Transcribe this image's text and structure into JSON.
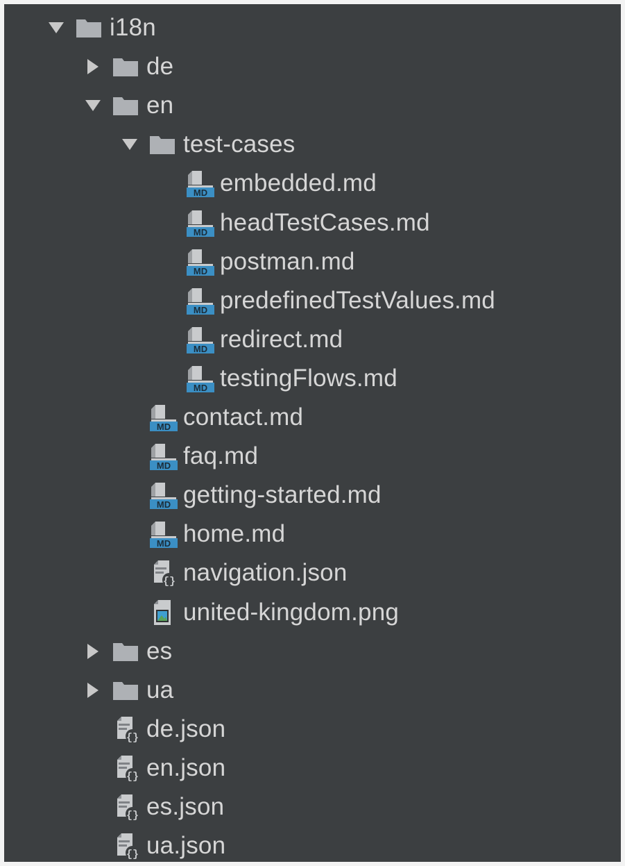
{
  "tree": {
    "items": [
      {
        "label": "i18n",
        "type": "folder",
        "expanded": true,
        "depth": 0
      },
      {
        "label": "de",
        "type": "folder",
        "expanded": false,
        "depth": 1
      },
      {
        "label": "en",
        "type": "folder",
        "expanded": true,
        "depth": 1
      },
      {
        "label": "test-cases",
        "type": "folder",
        "expanded": true,
        "depth": 2
      },
      {
        "label": "embedded.md",
        "type": "markdown",
        "depth": 3
      },
      {
        "label": "headTestCases.md",
        "type": "markdown",
        "depth": 3
      },
      {
        "label": "postman.md",
        "type": "markdown",
        "depth": 3
      },
      {
        "label": "predefinedTestValues.md",
        "type": "markdown",
        "depth": 3
      },
      {
        "label": "redirect.md",
        "type": "markdown",
        "depth": 3
      },
      {
        "label": "testingFlows.md",
        "type": "markdown",
        "depth": 3
      },
      {
        "label": "contact.md",
        "type": "markdown",
        "depth": 2
      },
      {
        "label": "faq.md",
        "type": "markdown",
        "depth": 2
      },
      {
        "label": "getting-started.md",
        "type": "markdown",
        "depth": 2
      },
      {
        "label": "home.md",
        "type": "markdown",
        "depth": 2
      },
      {
        "label": "navigation.json",
        "type": "json",
        "depth": 2
      },
      {
        "label": "united-kingdom.png",
        "type": "image",
        "depth": 2
      },
      {
        "label": "es",
        "type": "folder",
        "expanded": false,
        "depth": 1
      },
      {
        "label": "ua",
        "type": "folder",
        "expanded": false,
        "depth": 1
      },
      {
        "label": "de.json",
        "type": "json",
        "depth": 1
      },
      {
        "label": "en.json",
        "type": "json",
        "depth": 1
      },
      {
        "label": "es.json",
        "type": "json",
        "depth": 1
      },
      {
        "label": "ua.json",
        "type": "json",
        "depth": 1
      }
    ]
  },
  "icons": {
    "folder": "folder-icon",
    "markdown": "markdown-file-icon",
    "json": "json-file-icon",
    "image": "image-file-icon",
    "expanded": "chevron-down-icon",
    "collapsed": "chevron-right-icon",
    "md_badge_text": "MD"
  },
  "colors": {
    "background": "#3c3f41",
    "text": "#d6d6d6",
    "folder": "#aeb1b5",
    "arrow": "#c8c8c8",
    "md_badge": "#3b8fc4"
  }
}
